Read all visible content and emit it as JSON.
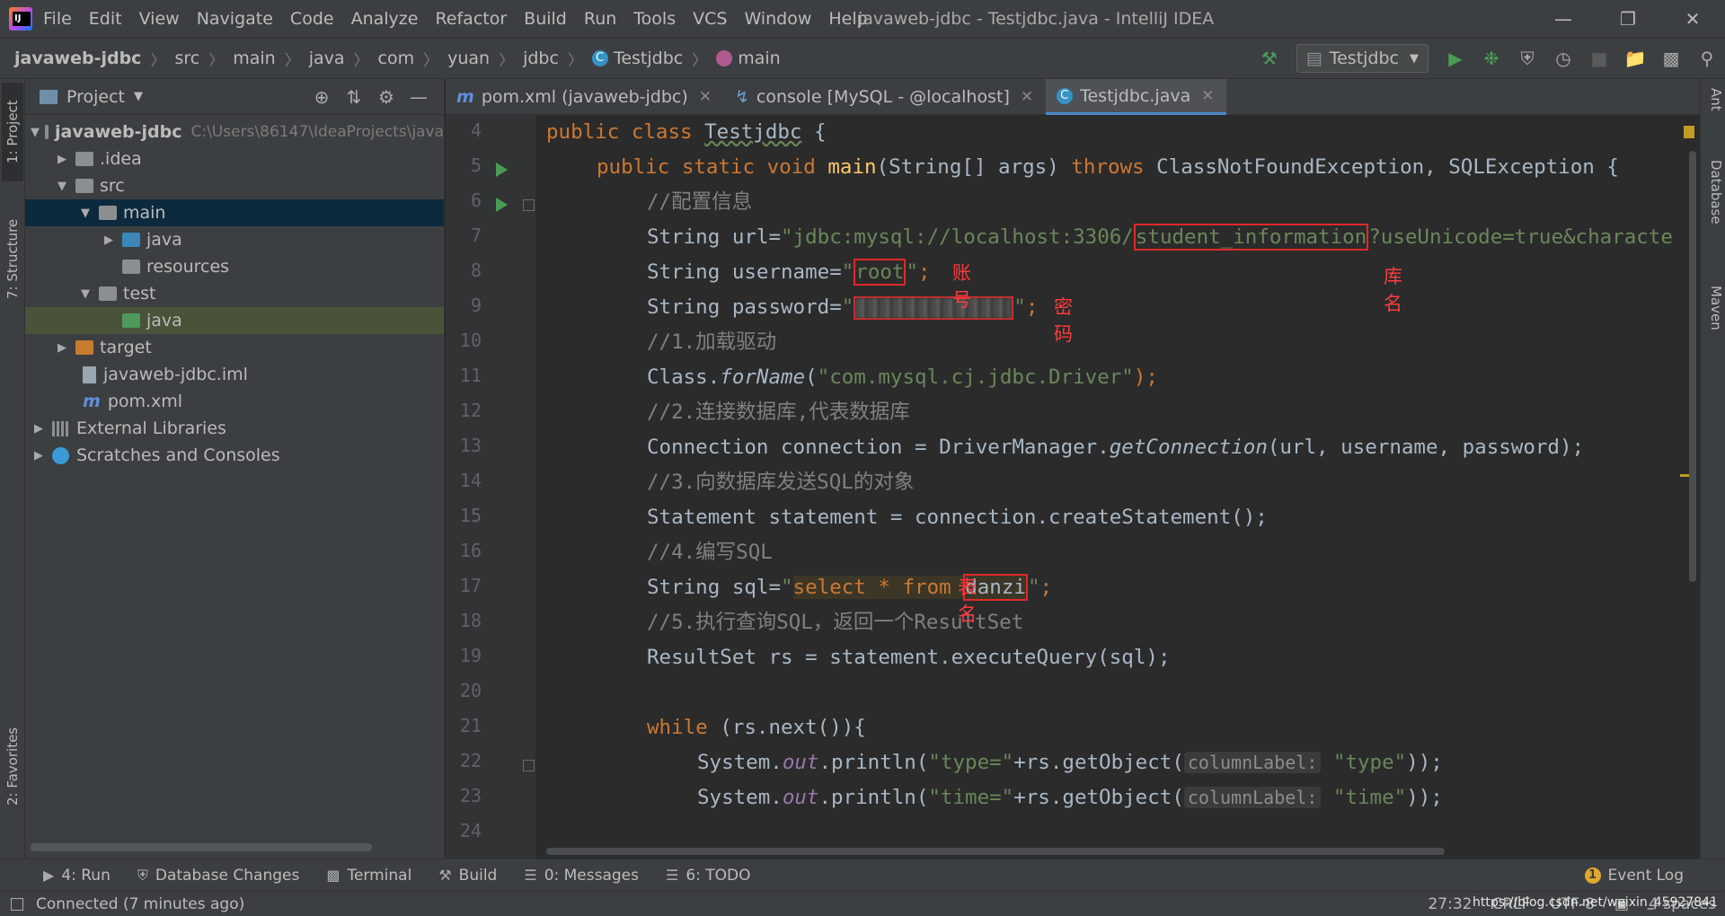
{
  "window": {
    "title": "javaweb-jdbc - Testjdbc.java - IntelliJ IDEA",
    "menu": [
      "File",
      "Edit",
      "View",
      "Navigate",
      "Code",
      "Analyze",
      "Refactor",
      "Build",
      "Run",
      "Tools",
      "VCS",
      "Window",
      "Help"
    ]
  },
  "breadcrumbs": [
    "javaweb-jdbc",
    "src",
    "main",
    "java",
    "com",
    "yuan",
    "jdbc",
    "Testjdbc",
    "main"
  ],
  "run_config": "Testjdbc",
  "left_stripe": {
    "project": "1: Project",
    "structure": "7: Structure",
    "favorites": "2: Favorites"
  },
  "right_stripe": {
    "ant": "Ant",
    "database": "Database",
    "maven": "Maven"
  },
  "project_panel": {
    "title": "Project",
    "tree": [
      {
        "label": "javaweb-jdbc",
        "hint": "C:\\Users\\86147\\IdeaProjects\\java"
      },
      {
        "label": ".idea"
      },
      {
        "label": "src"
      },
      {
        "label": "main"
      },
      {
        "label": "java"
      },
      {
        "label": "resources"
      },
      {
        "label": "test"
      },
      {
        "label": "java"
      },
      {
        "label": "target"
      },
      {
        "label": "javaweb-jdbc.iml"
      },
      {
        "label": "pom.xml"
      },
      {
        "label": "External Libraries"
      },
      {
        "label": "Scratches and Consoles"
      }
    ]
  },
  "tabs": [
    {
      "label": "pom.xml (javaweb-jdbc)"
    },
    {
      "label": "console [MySQL - @localhost]"
    },
    {
      "label": "Testjdbc.java"
    }
  ],
  "line_numbers": [
    "4",
    "5",
    "6",
    "7",
    "8",
    "9",
    "10",
    "11",
    "12",
    "13",
    "14",
    "15",
    "16",
    "17",
    "18",
    "19",
    "20",
    "21",
    "22",
    "23",
    "24"
  ],
  "code": {
    "l5": {
      "kw": "public class ",
      "name": "Testjdbc",
      "rest": " {"
    },
    "l6": {
      "kw1": "public static void ",
      "fn": "main",
      "mid": "(String[] args) ",
      "kw2": "throws ",
      "rest": "ClassNotFoundException, SQLException {"
    },
    "l7": "//配置信息",
    "l8": {
      "pre": "String url=",
      "s1": "\"jdbc:mysql://localhost:3306/",
      "db": "student_information",
      "s2": "?useUnicode=true&characte"
    },
    "l9": {
      "pre": "String username=",
      "q": "\"",
      "user": "root",
      "q2": "\"",
      "semi": ";"
    },
    "l10": {
      "pre": "String password=",
      "q": "\"",
      "q2": "\"",
      "semi": ";"
    },
    "l11": "//1.加载驱动",
    "l12": {
      "pre": "Class.",
      "call": "forName",
      "open": "(",
      "str": "\"com.mysql.cj.jdbc.Driver\"",
      "close": ");"
    },
    "l13": "//2.连接数据库,代表数据库",
    "l14": {
      "pre": "Connection connection = DriverManager.",
      "call": "getConnection",
      "rest": "(url, username, password);"
    },
    "l15": "//3.向数据库发送SQL的对象",
    "l16": "Statement statement = connection.createStatement();",
    "l17": "//4.编写SQL",
    "l18": {
      "pre": "String sql=",
      "q": "\"",
      "sql": "select * from ",
      "table": "danzi",
      "q2": "\"",
      "semi": ";"
    },
    "l19": "//5.执行查询SQL，返回一个ResultSet",
    "l20": "ResultSet rs = statement.executeQuery(sql);",
    "l22": {
      "kw": "while ",
      "rest": "(rs.next()){"
    },
    "l23": {
      "pre": "System.",
      "fld": "out",
      "mid": ".println(",
      "s": "\"type=\"",
      "plus": "+rs.getObject(",
      "hint": "columnLabel:",
      "arg": "\"type\"",
      "end": "));"
    },
    "l24": {
      "pre": "System.",
      "fld": "out",
      "mid": ".println(",
      "s": "\"time=\"",
      "plus": "+rs.getObject(",
      "hint": "columnLabel:",
      "arg": "\"time\"",
      "end": "));"
    }
  },
  "annotations": {
    "db_name": "库名",
    "account": "账号",
    "password": "密码",
    "table_name": "表名"
  },
  "bottom_tools": [
    "4: Run",
    "Database Changes",
    "Terminal",
    "Build",
    "0: Messages",
    "6: TODO"
  ],
  "event_log": {
    "label": "Event Log",
    "count": "1"
  },
  "status": {
    "message": "Connected (7 minutes ago)",
    "position": "27:32",
    "line_sep": "CRLF",
    "encoding": "UTF-8",
    "indent": "4 spaces",
    "watermark": "https://blog.csdn.net/weixin_45927841"
  }
}
